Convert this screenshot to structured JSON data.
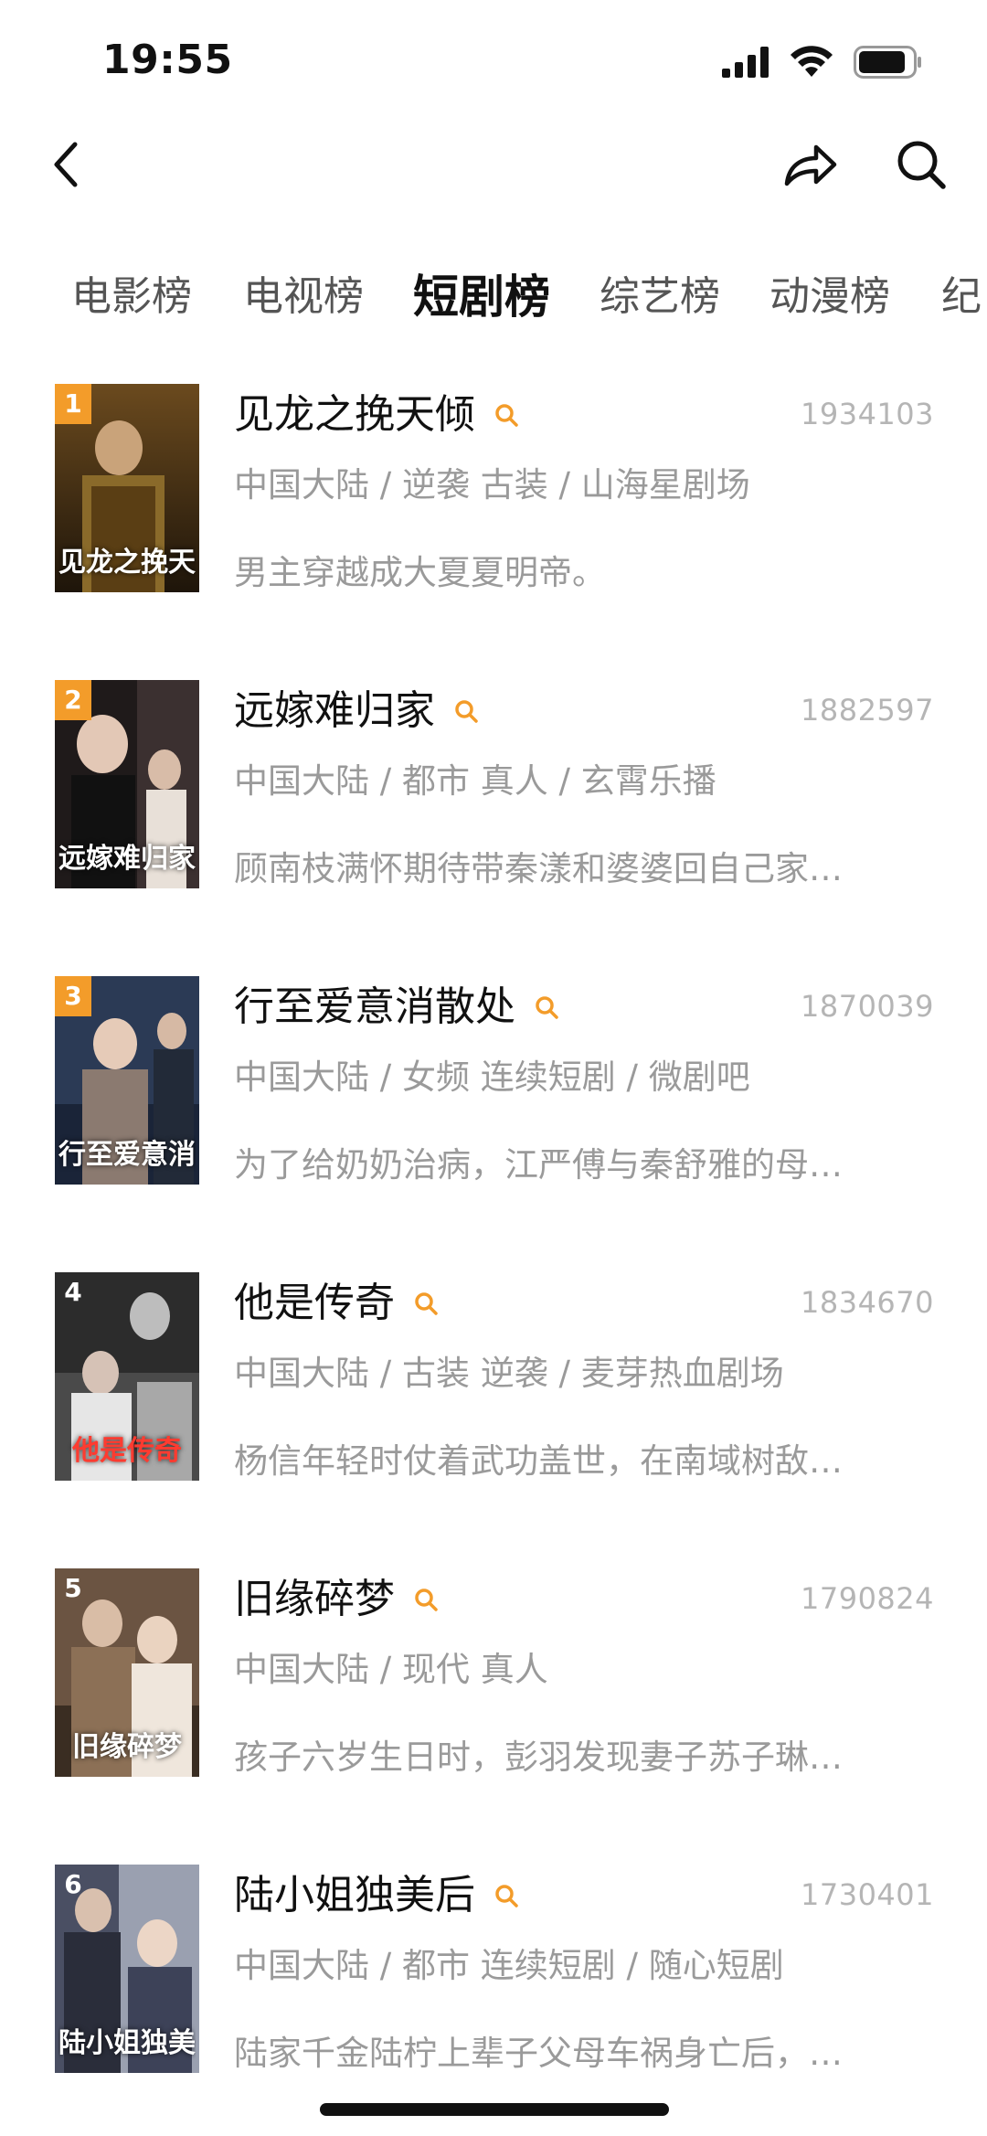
{
  "status_bar": {
    "time": "19:55"
  },
  "nav": {
    "back_icon": "chevron-left-icon",
    "share_icon": "share-arrow-icon",
    "search_icon": "search-icon"
  },
  "tabs": [
    {
      "label": "电影榜",
      "active": false
    },
    {
      "label": "电视榜",
      "active": false
    },
    {
      "label": "短剧榜",
      "active": true
    },
    {
      "label": "综艺榜",
      "active": false
    },
    {
      "label": "动漫榜",
      "active": false
    },
    {
      "label": "纪",
      "active": false
    }
  ],
  "colors": {
    "accent": "#f39c2a",
    "muted_text": "#9a9a9a",
    "score_text": "#b5b5b5"
  },
  "items": [
    {
      "rank": "1",
      "title": "见龙之挽天倾",
      "score": "1934103",
      "meta": "中国大陆 / 逆袭 古装 / 山海星剧场",
      "desc": "男主穿越成大夏夏明帝。",
      "poster_text": "见龙之挽天倾",
      "poster_colors": [
        "#3a2a14",
        "#8a6a2a"
      ]
    },
    {
      "rank": "2",
      "title": "远嫁难归家",
      "score": "1882597",
      "meta": "中国大陆 / 都市 真人 / 玄霄乐播",
      "desc": "顾南枝满怀期待带秦漾和婆婆回自己家…",
      "poster_text": "远嫁难归家",
      "poster_colors": [
        "#2a2020",
        "#bfb3a6"
      ]
    },
    {
      "rank": "3",
      "title": "行至爱意消散处",
      "score": "1870039",
      "meta": "中国大陆 / 女频 连续短剧 / 微剧吧",
      "desc": "为了给奶奶治病，江严傅与秦舒雅的母…",
      "poster_text": "行至爱意消散处",
      "poster_colors": [
        "#2b3a55",
        "#c9b5a8"
      ]
    },
    {
      "rank": "4",
      "title": "他是传奇",
      "score": "1834670",
      "meta": "中国大陆 / 古装 逆袭 / 麦芽热血剧场",
      "desc": "杨信年轻时仗着武功盖世，在南域树敌…",
      "poster_text": "他是传奇",
      "poster_colors": [
        "#3b3b3b",
        "#d9d9d9"
      ]
    },
    {
      "rank": "5",
      "title": "旧缘碎梦",
      "score": "1790824",
      "meta": "中国大陆 / 现代 真人",
      "desc": "孩子六岁生日时，彭羽发现妻子苏子琳…",
      "poster_text": "旧缘碎梦",
      "poster_colors": [
        "#5a4636",
        "#d9c7b2"
      ]
    },
    {
      "rank": "6",
      "title": "陆小姐独美后",
      "score": "1730401",
      "meta": "中国大陆 / 都市 连续短剧 / 随心短剧",
      "desc": "陆家千金陆柠上辈子父母车祸身亡后，…",
      "poster_text": "陆小姐独美",
      "poster_colors": [
        "#4a4f63",
        "#d8d2cc"
      ]
    }
  ]
}
